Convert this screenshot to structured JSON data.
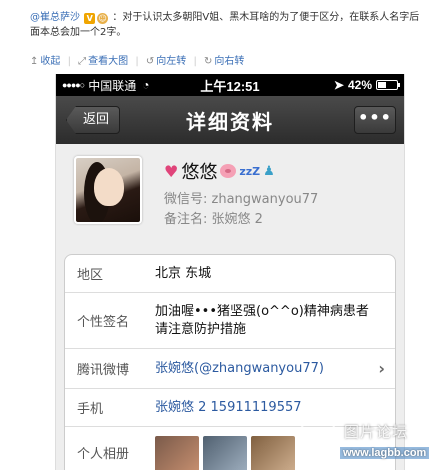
{
  "weibo": {
    "author": "@崔总萨沙",
    "text": "：对于认识太多朝阳V姐、黑木耳啥的为了便于区分，在联系人名字后面本总会加一个2字。",
    "actions": [
      "收起",
      "查看大图",
      "向左转",
      "向右转"
    ]
  },
  "status_bar": {
    "carrier": "中国联通",
    "time": "上午12:51",
    "battery_text": "42%",
    "battery_level": 0.42
  },
  "nav": {
    "back": "返回",
    "title": "详细资料",
    "more": "•••"
  },
  "profile": {
    "name": "悠悠",
    "zzz": "zzZ",
    "wechat_label": "微信号:",
    "wechat_id": "zhangwanyou77",
    "remark_label": "备注名:",
    "remark": "张婉悠 2"
  },
  "details": [
    {
      "label": "地区",
      "value": "北京 东城"
    },
    {
      "label": "个性签名",
      "value": "加油喔•••猪坚强(o^^o)精神病患者请注意防护措施"
    },
    {
      "label": "腾讯微博",
      "value": "张婉悠(@zhangwanyou77)"
    },
    {
      "label": "手机",
      "value": "张婉悠 2 15911119557"
    },
    {
      "label": "个人相册",
      "value": ""
    }
  ],
  "watermark": {
    "text": "图片论坛",
    "site": "www.lagbb.com"
  },
  "colors": {
    "link": "#2c5aa0",
    "weibo_link": "#3b6fb6",
    "navbar": "#3a3a3a"
  }
}
